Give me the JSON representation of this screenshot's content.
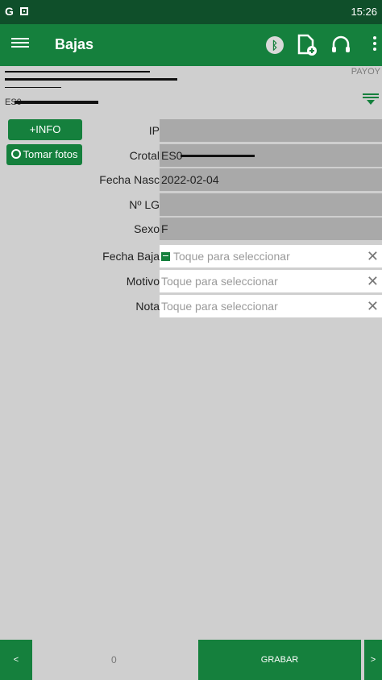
{
  "status": {
    "time": "15:26"
  },
  "appbar": {
    "title": "Bajas"
  },
  "header": {
    "payoy_label": "PAYOY",
    "animal_code": "ES0"
  },
  "buttons": {
    "info": "+INFO",
    "photos": "Tomar fotos"
  },
  "fields": [
    {
      "key": "ip",
      "label": "IP",
      "value": ""
    },
    {
      "key": "crotal",
      "label": "Crotal",
      "value": "ES0"
    },
    {
      "key": "fecha_nasc",
      "label": "Fecha Nasc",
      "value": "2022-02-04"
    },
    {
      "key": "no_lg",
      "label": "Nº LG",
      "value": ""
    },
    {
      "key": "sexo",
      "label": "Sexo",
      "value": "F"
    }
  ],
  "selects": [
    {
      "key": "fecha_baja",
      "label": "Fecha Baja",
      "placeholder": "Toque para seleccionar",
      "bold_label": true,
      "calendar": true
    },
    {
      "key": "motivo",
      "label": "Motivo",
      "placeholder": "Toque para seleccionar",
      "bold_label": true,
      "calendar": false
    },
    {
      "key": "nota",
      "label": "Nota",
      "placeholder": "Toque para seleccionar",
      "bold_label": true,
      "calendar": false
    }
  ],
  "bottom": {
    "prev": "<",
    "counter": "0",
    "save": "GRABAR",
    "next": ">"
  },
  "colors": {
    "primary": "#15803d",
    "statusbar": "#0f4f2a",
    "background": "#cfcfcf",
    "field": "#a9a9a9"
  },
  "icons": [
    "menu-icon",
    "bluetooth-icon",
    "add-document-icon",
    "headset-icon",
    "more-vert-icon",
    "filter-icon",
    "camera-icon",
    "calendar-icon",
    "clear-icon"
  ]
}
